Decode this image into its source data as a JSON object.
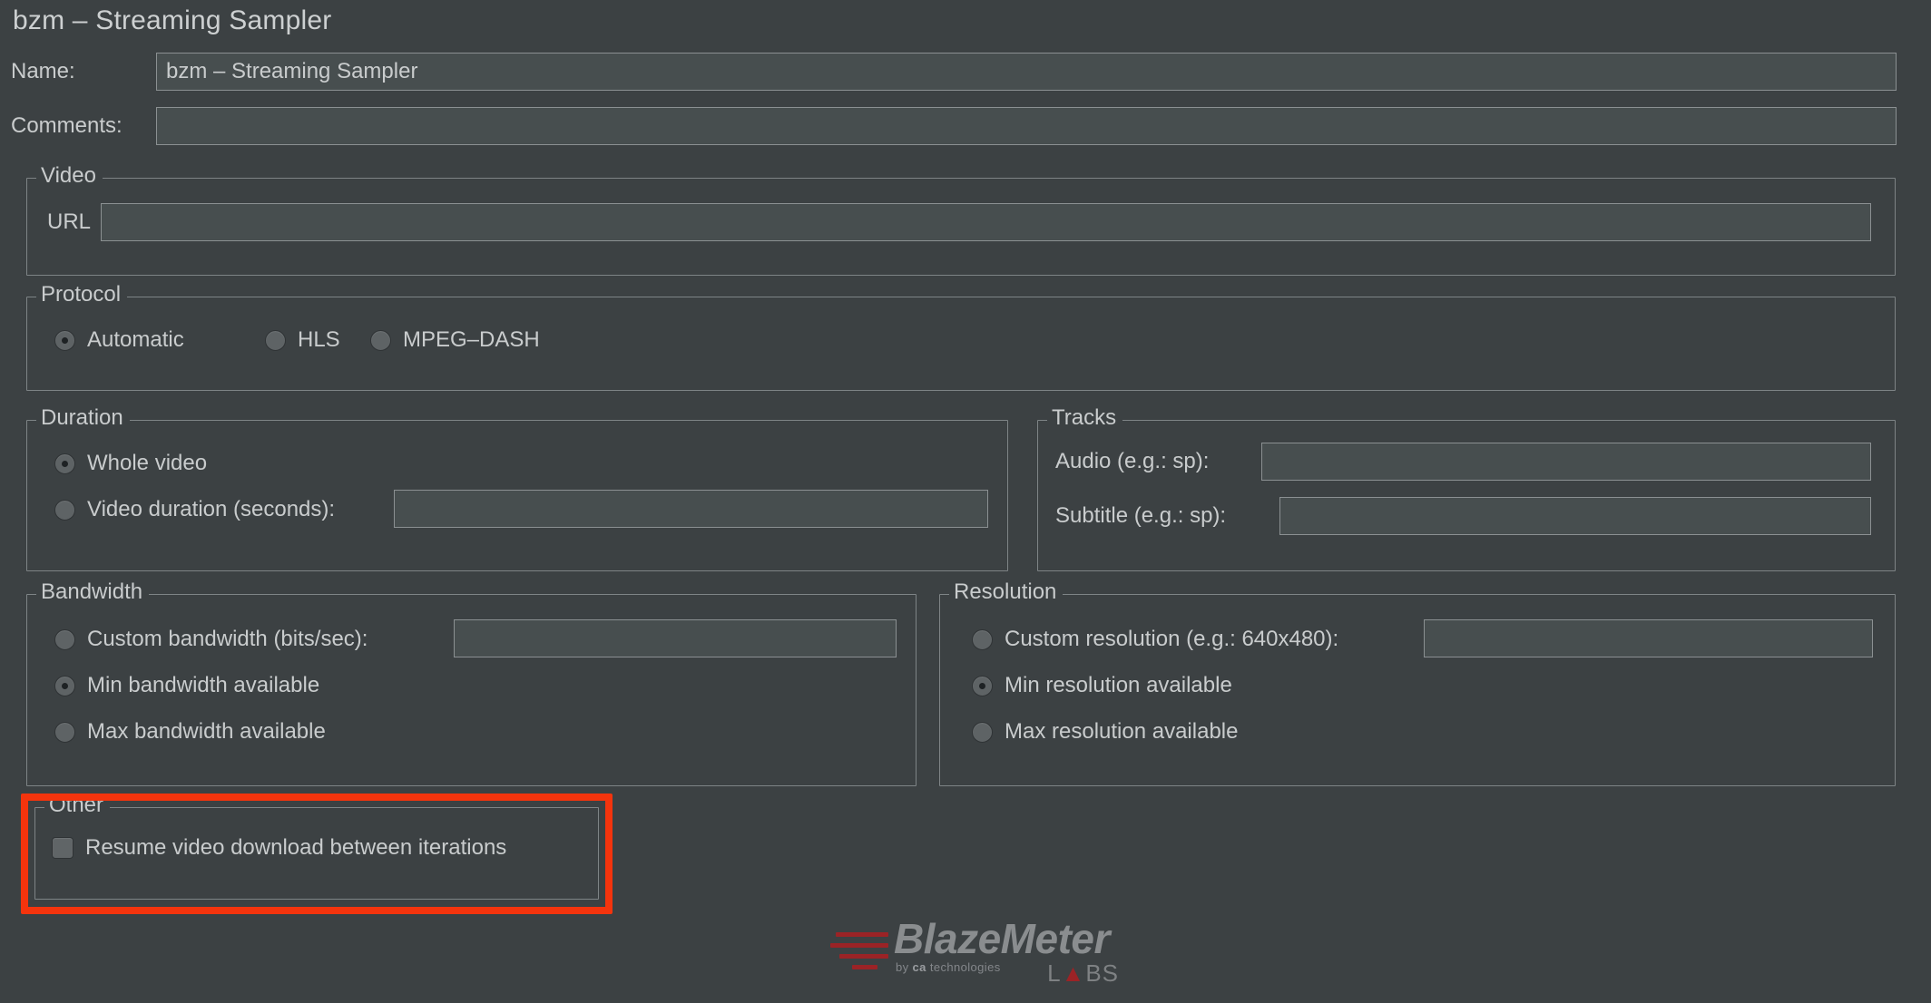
{
  "window": {
    "title": "bzm – Streaming Sampler",
    "background_color": "#3c4143",
    "accent_color": "#f4340d"
  },
  "top_fields": {
    "name": {
      "label": "Name:",
      "value": "bzm – Streaming Sampler",
      "placeholder": ""
    },
    "comments": {
      "label": "Comments:",
      "value": "",
      "placeholder": ""
    }
  },
  "video_group": {
    "legend": "Video",
    "url": {
      "label": "URL",
      "value": "",
      "placeholder": ""
    }
  },
  "protocol_group": {
    "legend": "Protocol",
    "options": [
      {
        "label": "Automatic",
        "selected": true
      },
      {
        "label": "HLS",
        "selected": false
      },
      {
        "label": "MPEG–DASH",
        "selected": false
      }
    ]
  },
  "duration_group": {
    "legend": "Duration",
    "options": [
      {
        "label": "Whole video",
        "selected": true
      },
      {
        "label": "Video duration (seconds):",
        "selected": false
      }
    ],
    "duration_value": "",
    "duration_placeholder": ""
  },
  "tracks_group": {
    "legend": "Tracks",
    "fields": [
      {
        "label": "Audio (e.g.: sp):",
        "value": "",
        "placeholder": ""
      },
      {
        "label": "Subtitle (e.g.: sp):",
        "value": "",
        "placeholder": ""
      }
    ]
  },
  "bandwidth_group": {
    "legend": "Bandwidth",
    "options": [
      {
        "label": "Custom bandwidth (bits/sec):",
        "selected": false
      },
      {
        "label": "Min bandwidth available",
        "selected": true
      },
      {
        "label": "Max bandwidth available",
        "selected": false
      }
    ],
    "custom_value": "",
    "custom_placeholder": ""
  },
  "resolution_group": {
    "legend": "Resolution",
    "options": [
      {
        "label": "Custom resolution (e.g.: 640x480):",
        "selected": false
      },
      {
        "label": "Min resolution available",
        "selected": true
      },
      {
        "label": "Max resolution available",
        "selected": false
      }
    ],
    "custom_value": "",
    "custom_placeholder": ""
  },
  "other_group": {
    "legend": "Other",
    "checkbox": {
      "label": "Resume video download between iterations",
      "checked": false
    },
    "highlighted": true
  },
  "footer_logo": {
    "name": "BlazeMeter",
    "byline_prefix": "by",
    "byline_brand": "ca",
    "byline_suffix": "technologies",
    "labs": "LABS"
  }
}
